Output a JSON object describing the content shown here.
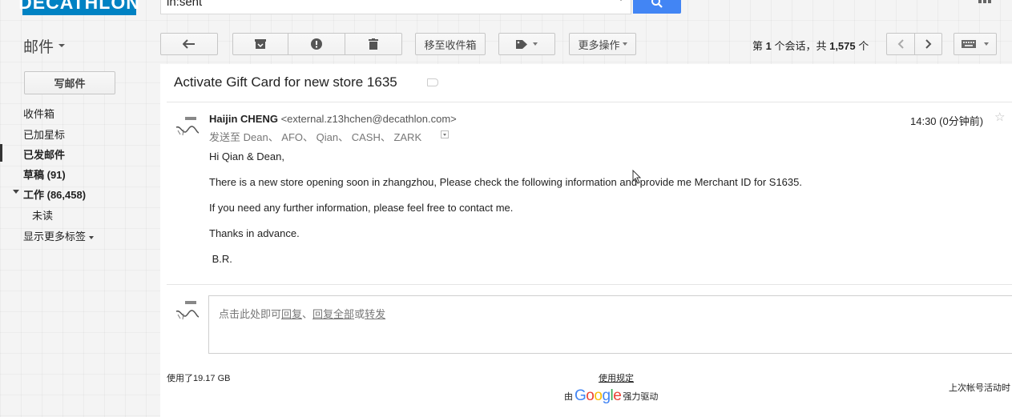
{
  "header": {
    "logo_text": "DECATHLON",
    "search_value": "in:sent",
    "brand_color": "#0082c3",
    "search_button_color": "#4285f4"
  },
  "toolbar": {
    "mail_label": "邮件",
    "move_to_inbox": "移至收件箱",
    "more_actions": "更多操作",
    "pager_prefix": "第 ",
    "pager_current": "1",
    "pager_middle": " 个会话，共 ",
    "pager_total": "1,575",
    "pager_suffix": " 个"
  },
  "sidebar": {
    "compose_label": "写邮件",
    "items": [
      {
        "label": "收件箱"
      },
      {
        "label": "已加星标"
      },
      {
        "label": "已发邮件"
      },
      {
        "label": "草稿 (91)"
      },
      {
        "label": "工作 (86,458)"
      },
      {
        "label": "未读"
      },
      {
        "label": "显示更多标签"
      }
    ]
  },
  "message": {
    "subject": "Activate Gift Card for new store 1635",
    "sender_name": "Haijin CHENG",
    "sender_email": "<external.z13hchen@decathlon.com>",
    "recipients": "发送至 Dean、 AFO、 Qian、 CASH、 ZARK",
    "time": "14:30 (0分钟前)",
    "body": [
      "Hi Qian & Dean,",
      "There is a new store opening soon in zhangzhou, Please check the following information and provide me Merchant ID for S1635.",
      "If you need any further information, please feel free to contact me.",
      "Thanks in advance.",
      " B.R."
    ]
  },
  "reply": {
    "prefix": "点击此处即可",
    "reply": "回复",
    "sep": "、",
    "reply_all": "回复全部",
    "or": "或",
    "forward": "转发"
  },
  "footer": {
    "storage": "使用了19.17 GB",
    "terms": "使用规定",
    "powered_prefix": "由",
    "powered_suffix": "强力驱动",
    "last_activity": "上次帐号活动时"
  }
}
